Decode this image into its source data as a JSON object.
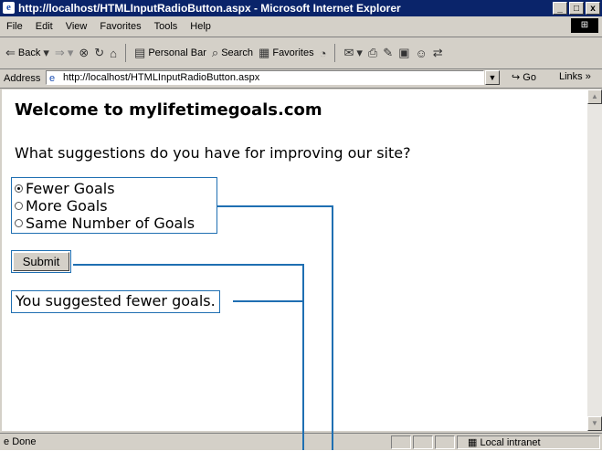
{
  "window": {
    "title": "http://localhost/HTMLInputRadioButton.aspx - Microsoft Internet Explorer",
    "controls": [
      "_",
      "□",
      "x"
    ]
  },
  "menubar": {
    "items": [
      "File",
      "Edit",
      "View",
      "Favorites",
      "Tools",
      "Help"
    ]
  },
  "toolbar": {
    "back_label": "Back",
    "personal_bar_label": "Personal Bar",
    "search_label": "Search",
    "favorites_label": "Favorites"
  },
  "addressbar": {
    "label": "Address",
    "url": "http://localhost/HTMLInputRadioButton.aspx",
    "go_label": "Go",
    "links_label": "Links »"
  },
  "page": {
    "heading": "Welcome to mylifetimegoals.com",
    "question": "What suggestions do you have for improving our site?",
    "radio_options": [
      {
        "label": "Fewer Goals",
        "checked": true
      },
      {
        "label": "More Goals",
        "checked": false
      },
      {
        "label": "Same Number of Goals",
        "checked": false
      }
    ],
    "submit_label": "Submit",
    "result_text": "You suggested fewer goals."
  },
  "statusbar": {
    "status": "Done",
    "zone": "Local intranet"
  },
  "colors": {
    "titlebar": "#0a246a",
    "chrome": "#d4d0c8",
    "callout": "#1f6fb2"
  }
}
